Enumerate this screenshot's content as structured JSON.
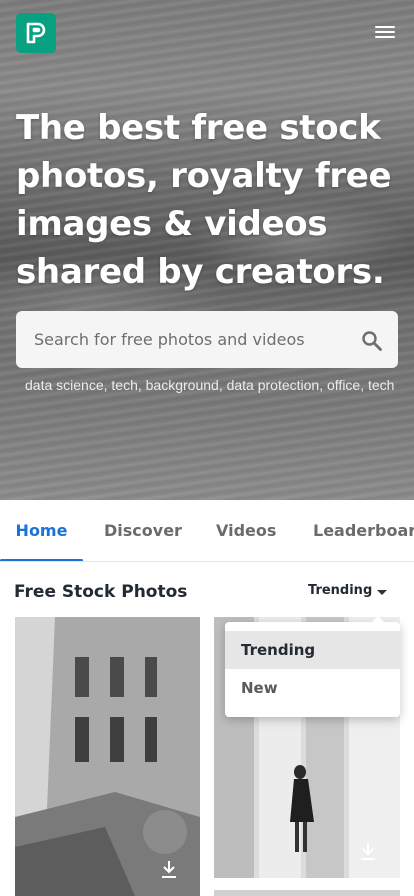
{
  "header": {
    "logo_icon": "pexels-logo-icon",
    "menu_icon": "hamburger-menu-icon",
    "brand_color": "#07a081"
  },
  "hero": {
    "headline": "The best free stock photos, royalty free images & videos shared by creators.",
    "search": {
      "placeholder": "Search for free photos and videos",
      "icon": "search-icon"
    },
    "tags": [
      "data science",
      "tech",
      "background",
      "data protection",
      "office",
      "tech"
    ]
  },
  "tabs": [
    {
      "label": "Home",
      "active": true
    },
    {
      "label": "Discover",
      "active": false
    },
    {
      "label": "Videos",
      "active": false
    },
    {
      "label": "Leaderboard",
      "active": false
    }
  ],
  "section": {
    "title": "Free Stock Photos",
    "sort_value": "Trending",
    "sort_options": [
      "Trending",
      "New"
    ],
    "accent_color": "#1a73d6"
  },
  "photos": [
    {
      "name": "building-photo",
      "download_icon": "download-icon"
    },
    {
      "name": "woman-columns-photo",
      "download_icon": "download-icon"
    }
  ]
}
